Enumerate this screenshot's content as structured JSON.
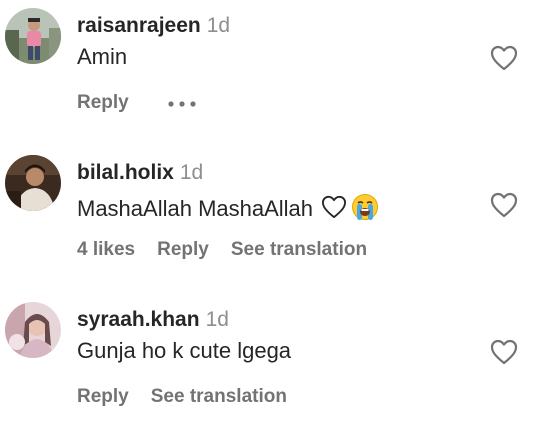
{
  "comments": [
    {
      "username": "raisanrajeen",
      "time": "1d",
      "text": "Amin",
      "reply_label": "Reply",
      "more_icon": "ellipsis-icon",
      "like_icon": "heart-outline-icon"
    },
    {
      "username": "bilal.holix",
      "time": "1d",
      "text": "MashaAllah MashaAllah",
      "text_emojis": [
        "white-heart",
        "loudly-crying-face"
      ],
      "likes_label": "4 likes",
      "reply_label": "Reply",
      "translate_label": "See translation",
      "like_icon": "heart-outline-icon"
    },
    {
      "username": "syraah.khan",
      "time": "1d",
      "text": "Gunja ho k cute lgega",
      "reply_label": "Reply",
      "translate_label": "See translation",
      "like_icon": "heart-outline-icon"
    }
  ],
  "colors": {
    "primary_text": "#262626",
    "secondary_text": "#8e8e8e",
    "action_text": "#737373",
    "background": "#ffffff"
  }
}
